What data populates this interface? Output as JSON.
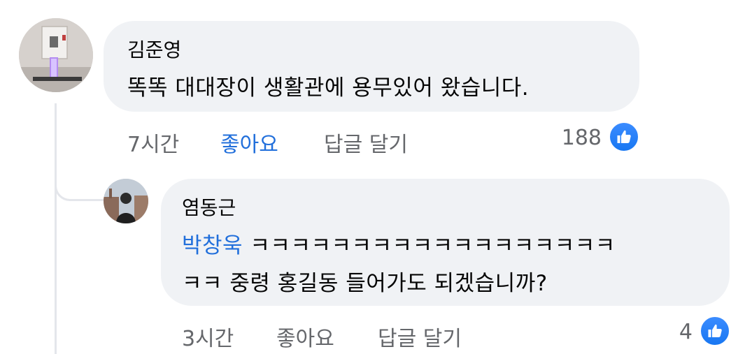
{
  "comment": {
    "author": "김준영",
    "text": "똑똑 대대장이 생활관에 용무있어 왔습니다.",
    "time": "7시간",
    "like_label": "좋아요",
    "reply_label": "답글 달기",
    "reaction_count": "188"
  },
  "reply": {
    "author": "염동근",
    "mention": "박창욱",
    "line1_rest": " ㅋㅋㅋㅋㅋㅋㅋㅋㅋㅋㅋㅋㅋㅋㅋㅋㅋㅋ",
    "line2": "ㅋㅋ 중령 홍길동 들어가도 되겠습니까?",
    "time": "3시간",
    "like_label": "좋아요",
    "reply_label": "답글 달기",
    "reaction_count": "4"
  },
  "colors": {
    "bubble": "#f0f2f5",
    "accent": "#216fdb",
    "meta": "#65676b",
    "thread_line": "#e4e6eb"
  },
  "icons": {
    "reaction": "thumbs-up-icon"
  }
}
